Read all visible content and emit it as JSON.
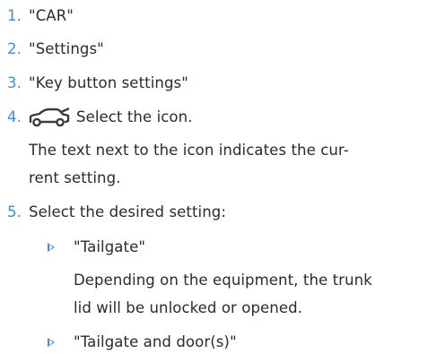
{
  "steps": [
    {
      "number": "1.",
      "text": "\"CAR\""
    },
    {
      "number": "2.",
      "text": "\"Settings\""
    },
    {
      "number": "3.",
      "text": "\"Key button settings\""
    },
    {
      "number": "4.",
      "text": "Select the icon.",
      "icon": "car-trunk-open-icon",
      "note": [
        "The text next to the icon indicates the cur-",
        "rent setting."
      ]
    },
    {
      "number": "5.",
      "text": "Select the desired setting:"
    }
  ],
  "options": [
    {
      "label": "\"Tailgate\"",
      "description": [
        "Depending on the equipment, the trunk",
        "lid will be unlocked or opened."
      ]
    },
    {
      "label": "\"Tailgate and door(s)\""
    }
  ],
  "colors": {
    "accent": "#3f8fd0",
    "text": "#2b2b2b",
    "background": "#ffffff"
  }
}
